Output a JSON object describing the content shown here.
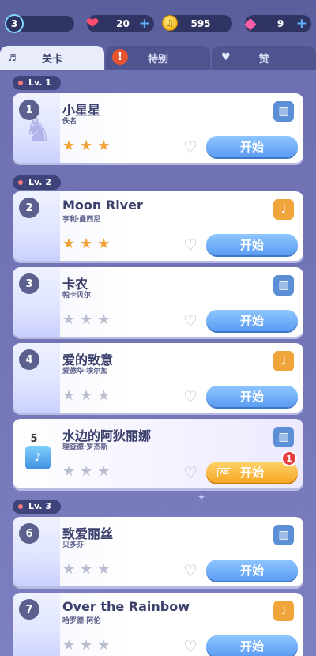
{
  "topbar": {
    "player_level": "3",
    "hearts": "20",
    "coins": "595",
    "gems": "9",
    "plus": "+"
  },
  "tabs": [
    {
      "label": "关卡"
    },
    {
      "label": "特别"
    },
    {
      "label": "赞"
    }
  ],
  "alert_mark": "!",
  "levels": [
    {
      "label": "Lv. 1"
    },
    {
      "label": "Lv. 2"
    },
    {
      "label": "Lv. 3"
    }
  ],
  "songs": [
    {
      "num": "1",
      "title": "小星星",
      "artist": "佚名",
      "stars": 3,
      "instrument": "piano-icon",
      "start": "开始"
    },
    {
      "num": "2",
      "title": "Moon River",
      "artist": "亨利·曼西尼",
      "stars": 3,
      "instrument": "guitar-icon",
      "start": "开始"
    },
    {
      "num": "3",
      "title": "卡农",
      "artist": "帕卡贝尔",
      "stars": 0,
      "instrument": "piano-icon",
      "start": "开始"
    },
    {
      "num": "4",
      "title": "爱的致意",
      "artist": "爱德华·埃尔加",
      "stars": 0,
      "instrument": "guitar-icon",
      "start": "开始"
    },
    {
      "num": "5",
      "title": "水边的阿狄丽娜",
      "artist": "理查德·罗杰斯",
      "stars": 0,
      "instrument": "piano-icon",
      "start": "开始",
      "ad_label": "AD",
      "badge": "1"
    },
    {
      "num": "6",
      "title": "致爱丽丝",
      "artist": "贝多芬",
      "stars": 0,
      "instrument": "piano-icon",
      "start": "开始"
    },
    {
      "num": "7",
      "title": "Over the Rainbow",
      "artist": "哈罗德·阿伦",
      "stars": 0,
      "instrument": "guitar-icon",
      "start": "开始"
    }
  ],
  "colors": {
    "star_on": "#f2a33a",
    "star_off": "#b9bdd0",
    "start_button": "#5a9cf2",
    "start_button_ad": "#f5a623",
    "badge": "#ea3d3d"
  }
}
